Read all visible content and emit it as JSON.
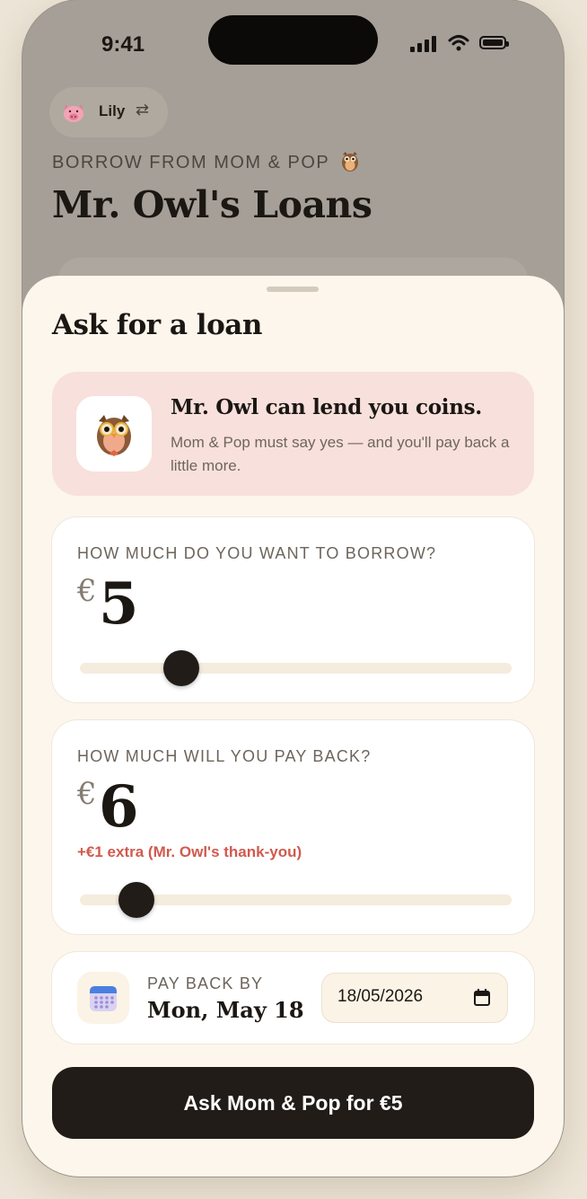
{
  "status_bar": {
    "time": "9:41"
  },
  "profile": {
    "name": "Lily",
    "avatar_icon": "pig-face-icon",
    "switch_icon": "swap-arrows-icon"
  },
  "header": {
    "eyebrow": "BORROW FROM MOM & POP",
    "eyebrow_icon": "owl-icon",
    "title": "Mr. Owl's Loans"
  },
  "sheet": {
    "title": "Ask for a loan",
    "info": {
      "title": "Mr. Owl can lend you coins.",
      "body": "Mom & Pop must say yes — and you'll pay back a little more.",
      "icon": "owl-icon"
    },
    "borrow": {
      "label": "HOW MUCH DO YOU WANT TO BORROW?",
      "currency": "€",
      "amount": "5",
      "slider_fraction": 0.235
    },
    "payback": {
      "label": "HOW MUCH WILL YOU PAY BACK?",
      "currency": "€",
      "amount": "6",
      "extra": "+€1 extra (Mr. Owl's thank-you)",
      "slider_fraction": 0.13
    },
    "due": {
      "label": "PAY BACK BY",
      "value": "Mon, May 18",
      "input_value": "18/05/2026",
      "icon": "calendar-icon"
    },
    "cta": "Ask Mom & Pop for €5"
  },
  "colors": {
    "sheet_bg": "#fcf6ec",
    "info_bg": "#f8e0dc",
    "accent_dark": "#221c18",
    "extra_red": "#d05a4e"
  }
}
